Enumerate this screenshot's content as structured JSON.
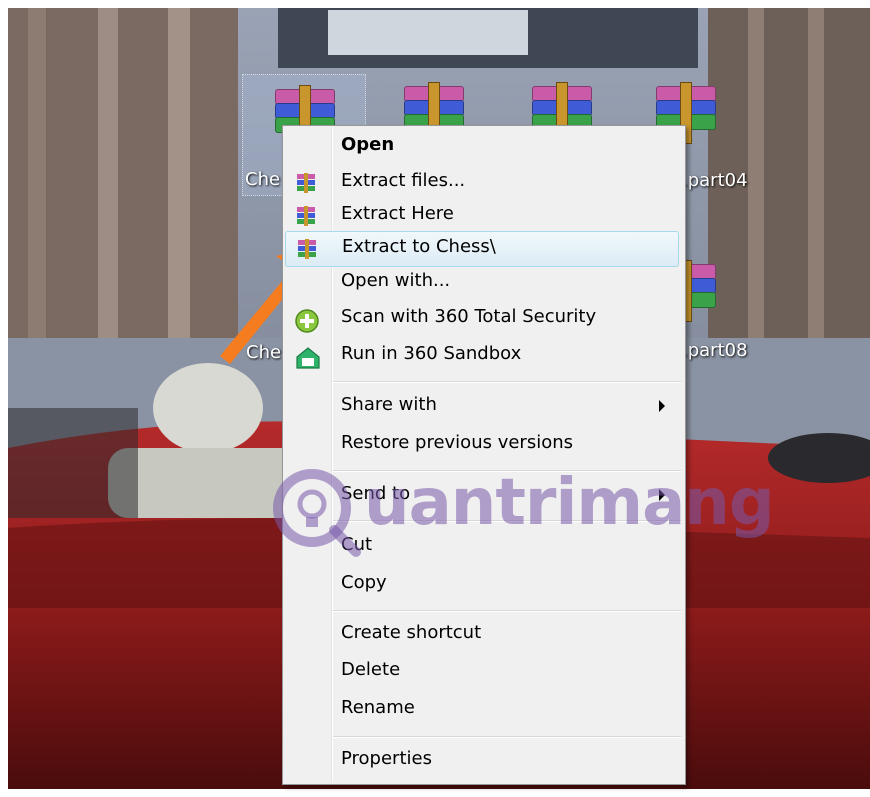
{
  "desktop": {
    "icons": [
      {
        "label": "Che"
      },
      {
        "label": ""
      },
      {
        "label": ""
      },
      {
        "label": ".part04"
      },
      {
        "label": "Che"
      },
      {
        "label": ".part08"
      }
    ]
  },
  "context_menu": {
    "items": [
      {
        "label": "Open",
        "icon": "",
        "bold": true
      },
      {
        "label": "Extract files...",
        "icon": "winrar-icon"
      },
      {
        "label": "Extract Here",
        "icon": "winrar-icon"
      },
      {
        "label": "Extract to Chess\\",
        "icon": "winrar-icon",
        "highlighted": true
      },
      {
        "label": "Open with...",
        "icon": ""
      },
      {
        "label": "Scan with 360 Total Security",
        "icon": "360-security-icon"
      },
      {
        "label": "Run in 360 Sandbox",
        "icon": "360-sandbox-icon"
      },
      {
        "label": "Share with",
        "submenu": true
      },
      {
        "label": "Restore previous versions"
      },
      {
        "label": "Send to",
        "submenu": true
      },
      {
        "label": "Cut"
      },
      {
        "label": "Copy"
      },
      {
        "label": "Create shortcut"
      },
      {
        "label": "Delete"
      },
      {
        "label": "Rename"
      },
      {
        "label": "Properties"
      }
    ]
  },
  "watermark": {
    "text": "uantrimang"
  },
  "colors": {
    "menu_bg": "#f0f0f0",
    "highlight_border": "#a8d8eb",
    "arrow": "#f57c1f",
    "car": "#8e1b1b"
  }
}
